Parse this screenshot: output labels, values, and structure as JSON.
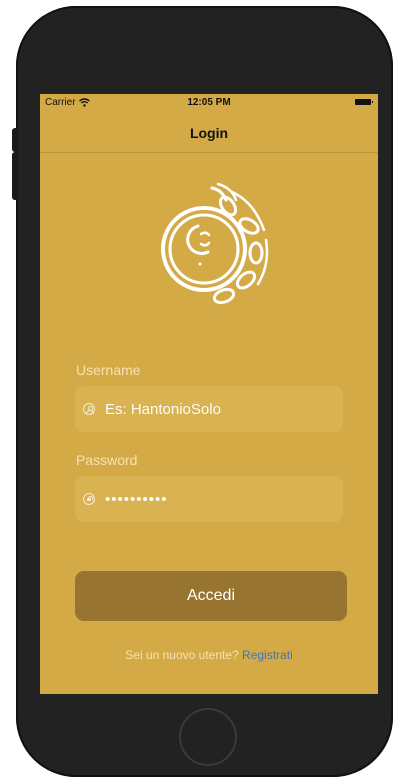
{
  "status_bar": {
    "carrier": "Carrier",
    "time": "12:05 PM",
    "wifi_icon": "wifi-icon",
    "battery_icon": "battery-icon"
  },
  "nav": {
    "title": "Login"
  },
  "logo": {
    "icon": "moon-tambourine-logo",
    "color": "#ffffff"
  },
  "form": {
    "username": {
      "label": "Username",
      "placeholder": "Es: HantonioSolo",
      "value": "",
      "icon": "person-icon"
    },
    "password": {
      "label": "Password",
      "value": "••••••••••",
      "icon": "lock-icon"
    },
    "submit_label": "Accedi"
  },
  "footer": {
    "prompt": "Sei un nuovo utente?",
    "link": "Registrati"
  },
  "colors": {
    "background": "#d4aa47",
    "field_bg": "#d9b252",
    "button_bg": "#977430",
    "link": "#3a73c9",
    "device": "#222222"
  }
}
